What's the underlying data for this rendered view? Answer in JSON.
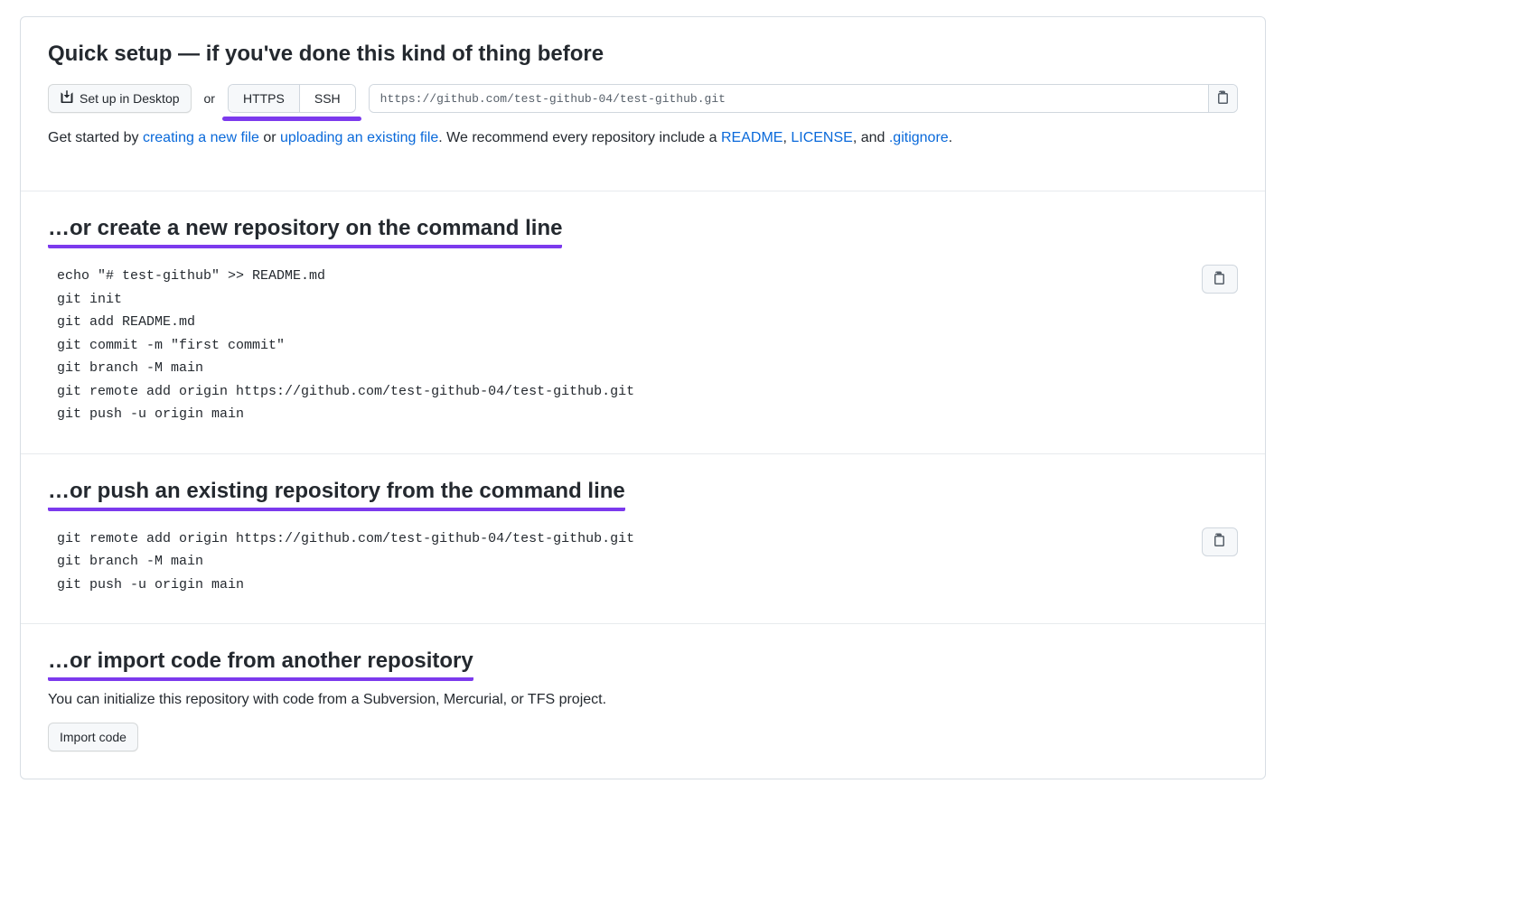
{
  "quick_setup": {
    "heading": "Quick setup — if you've done this kind of thing before",
    "desktop_button": "Set up in Desktop",
    "or_label": "or",
    "https_label": "HTTPS",
    "ssh_label": "SSH",
    "clone_url": "https://github.com/test-github-04/test-github.git",
    "get_started_prefix": "Get started by ",
    "link_create_file": "creating a new file",
    "mid_or": " or ",
    "link_upload_file": "uploading an existing file",
    "get_started_mid": ". We recommend every repository include a ",
    "link_readme": "README",
    "comma_sep": ", ",
    "link_license": "LICENSE",
    "and_sep": ", and ",
    "link_gitignore": ".gitignore",
    "period": "."
  },
  "create_new": {
    "heading": "…or create a new repository on the command line",
    "code": "echo \"# test-github\" >> README.md\ngit init\ngit add README.md\ngit commit -m \"first commit\"\ngit branch -M main\ngit remote add origin https://github.com/test-github-04/test-github.git\ngit push -u origin main"
  },
  "push_existing": {
    "heading": "…or push an existing repository from the command line",
    "code": "git remote add origin https://github.com/test-github-04/test-github.git\ngit branch -M main\ngit push -u origin main"
  },
  "import_repo": {
    "heading": "…or import code from another repository",
    "description": "You can initialize this repository with code from a Subversion, Mercurial, or TFS project.",
    "button": "Import code"
  }
}
